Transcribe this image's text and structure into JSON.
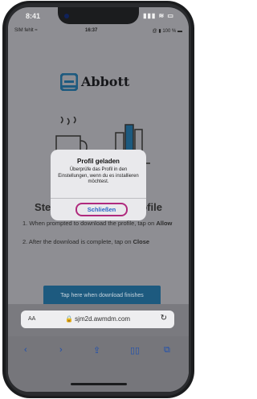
{
  "outer_status": {
    "time": "8:41",
    "icons": "▮▮▮ ≋ ▭"
  },
  "inner_status": {
    "carrier": "SIM fehlt ≈",
    "time": "16:37",
    "right": "@ ▮ 100 % ▬"
  },
  "page": {
    "logo_text": "Abbott",
    "steps_title": "Steps to download profile",
    "step1": "1. When prompted to download the profile, tap on",
    "step1_bold": "Allow",
    "step2": "2. After the download is complete, tap on",
    "step2_bold": "Close",
    "tap_button": "Tap here when download finishes"
  },
  "alert": {
    "title": "Profil geladen",
    "message": "Überprüfe das Profil in den Einstellungen, wenn du es installieren möchtest.",
    "button": "Schließen",
    "highlight_color": "#b02a7d"
  },
  "urlbar": {
    "aa": "AA",
    "url": "🔒 sjm2d.awmdm.com",
    "reload": "↻"
  },
  "toolbar": {
    "back": "‹",
    "forward": "›",
    "share": "⇪",
    "bookmarks": "▯▯",
    "tabs": "⧉"
  }
}
